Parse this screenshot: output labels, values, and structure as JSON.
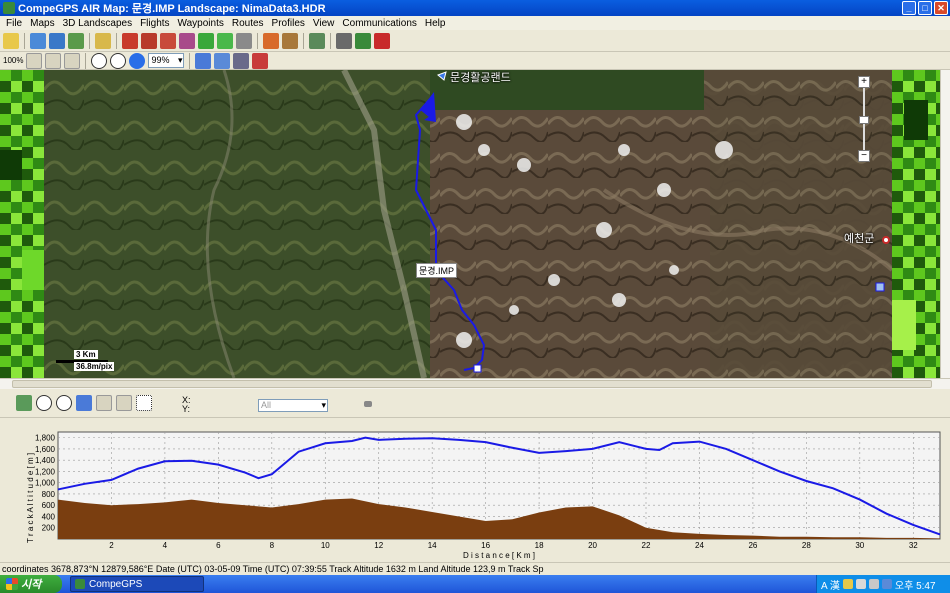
{
  "window": {
    "title": "CompeGPS AIR Map: 문경.IMP Landscape: NimaData3.HDR",
    "minimize": "_",
    "maximize": "□",
    "close": "✕"
  },
  "menu": [
    "File",
    "Maps",
    "3D Landscapes",
    "Flights",
    "Waypoints",
    "Routes",
    "Profiles",
    "View",
    "Communications",
    "Help"
  ],
  "toolbar": {
    "zoom_level": "99%",
    "percent_button": "100%"
  },
  "map": {
    "place_label_top": "문경활공랜드",
    "place_label_right": "예천군",
    "track_label": "문경.IMP",
    "scale_km": "3 Km",
    "scale_pix": "36.8m/pix"
  },
  "profile_toolbar": {
    "x_label": "X:",
    "y_label": "Y:",
    "filter_value": "All"
  },
  "chart_data": {
    "type": "area",
    "ylabel": "T r a c k   A l t i t u d e   [ m ]",
    "xlabel": "D i s t a n c e   [ K m ]",
    "xlim": [
      0,
      33
    ],
    "ylim": [
      0,
      1900
    ],
    "x_ticks": [
      2,
      4,
      6,
      8,
      10,
      12,
      14,
      16,
      18,
      20,
      22,
      24,
      26,
      28,
      30,
      32
    ],
    "y_ticks": [
      200,
      400,
      600,
      800,
      1000,
      1200,
      1400,
      1600,
      1800
    ],
    "y_tick_labels": [
      "200",
      "400",
      "600",
      "800",
      "1,000",
      "1,200",
      "1,400",
      "1,600",
      "1,800"
    ],
    "colors": {
      "track": "#1a1ae6",
      "terrain": "#7a3e10",
      "plot_bg": "#f4f4f4",
      "grid": "#9a9a9a"
    },
    "series": [
      {
        "x": [
          0,
          1,
          2,
          3,
          4,
          5,
          6,
          7,
          7.5,
          8,
          9,
          10,
          11,
          11.5,
          12,
          13,
          14,
          15,
          16,
          17,
          18,
          19,
          20,
          21,
          22,
          22.5,
          23,
          24,
          25,
          26,
          27,
          28,
          29,
          30,
          31,
          32,
          33
        ],
        "y": [
          880,
          980,
          1050,
          1250,
          1380,
          1390,
          1320,
          1180,
          1080,
          1150,
          1550,
          1700,
          1740,
          1800,
          1760,
          1780,
          1790,
          1760,
          1720,
          1620,
          1530,
          1560,
          1600,
          1720,
          1600,
          1580,
          1700,
          1730,
          1600,
          1400,
          1200,
          1030,
          900,
          700,
          450,
          250,
          80
        ]
      },
      {
        "x": [
          0,
          1,
          2,
          3,
          4,
          5,
          6,
          7,
          8,
          9,
          10,
          11,
          12,
          13,
          14,
          15,
          16,
          17,
          18,
          19,
          20,
          21,
          22,
          23,
          24,
          25,
          26,
          27,
          28,
          29,
          30,
          31,
          32,
          33
        ],
        "y": [
          700,
          640,
          600,
          620,
          650,
          700,
          640,
          600,
          560,
          620,
          700,
          720,
          620,
          560,
          480,
          400,
          320,
          350,
          470,
          560,
          580,
          420,
          200,
          120,
          90,
          70,
          60,
          40,
          40,
          30,
          30,
          20,
          20,
          10
        ]
      }
    ]
  },
  "status": {
    "text": "coordinates 3678,873°N 12879,586°E Date (UTC) 03-05-09 Time (UTC) 07:39:55 Track Altitude 1632 m Land Altitude 123,9 m Track Sp"
  },
  "taskbar": {
    "start": "시작",
    "task_app": "CompeGPS",
    "clock": "오후 5:47",
    "ime": "A 漢"
  }
}
